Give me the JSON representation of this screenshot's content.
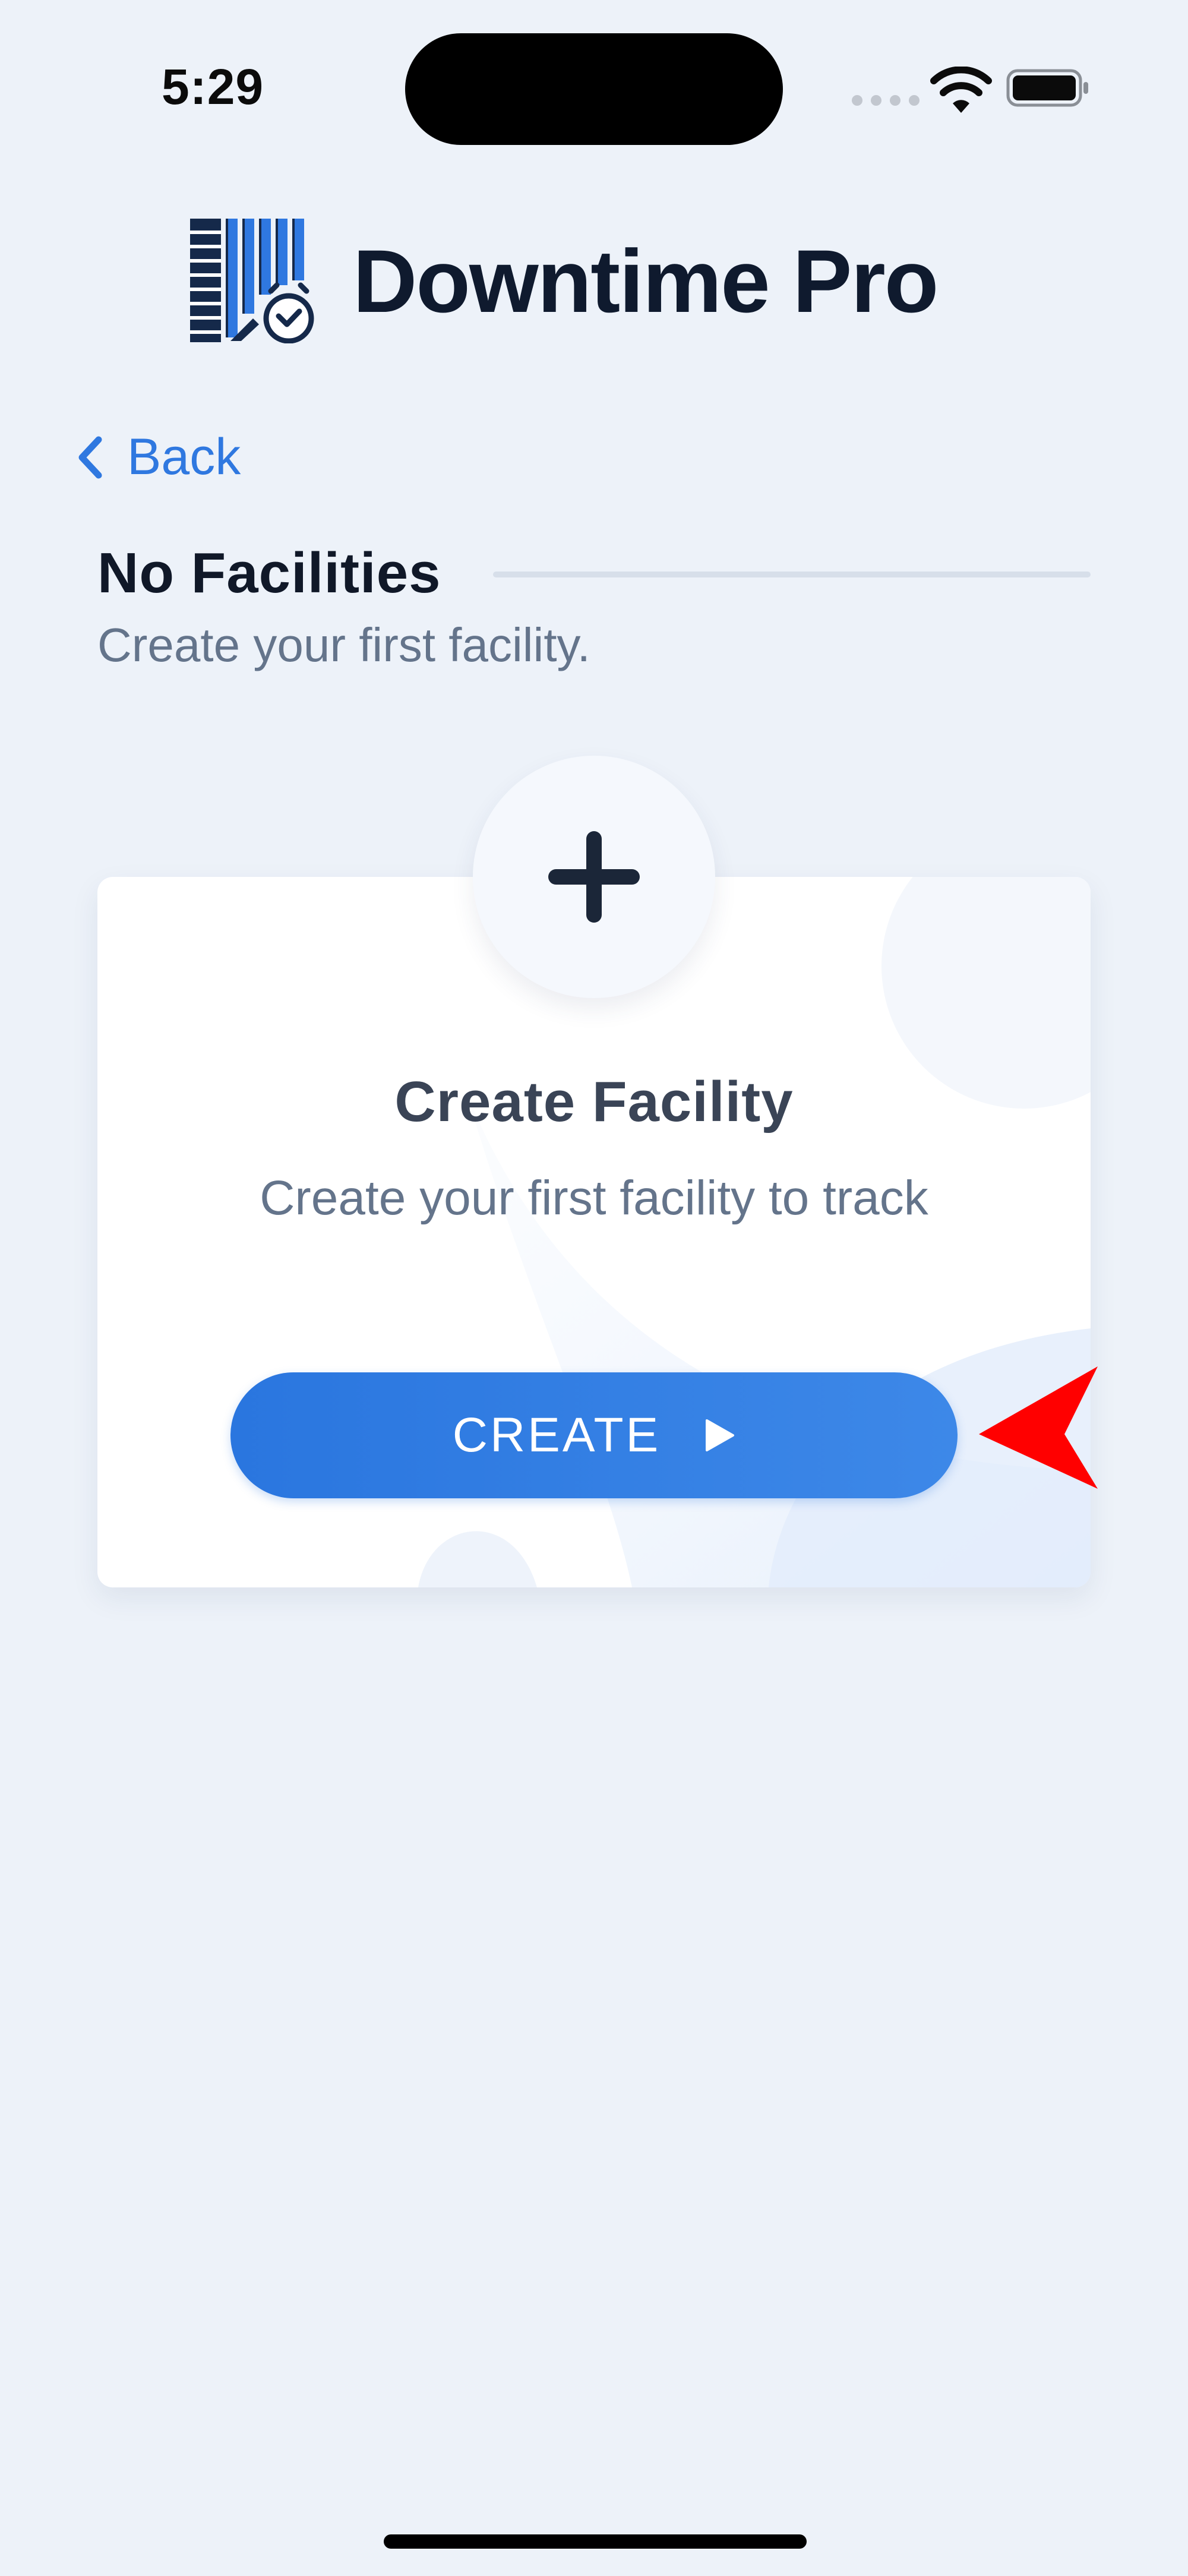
{
  "status_bar": {
    "time": "5:29"
  },
  "app": {
    "name": "Downtime Pro",
    "logo_icon": "barcode-clock-icon"
  },
  "navigation": {
    "back_label": "Back",
    "back_icon": "chevron-left-icon"
  },
  "section": {
    "title": "No Facilities",
    "subtitle": "Create your first facility."
  },
  "card": {
    "icon": "plus-icon",
    "title": "Create Facility",
    "description": "Create your first facility to track",
    "button_label": "CREATE",
    "button_icon": "play-icon"
  },
  "colors": {
    "background": "#edf2f9",
    "accent": "#2f78e0",
    "text_dark": "#101828",
    "text_muted": "#64748b",
    "pointer": "#ff0000"
  }
}
